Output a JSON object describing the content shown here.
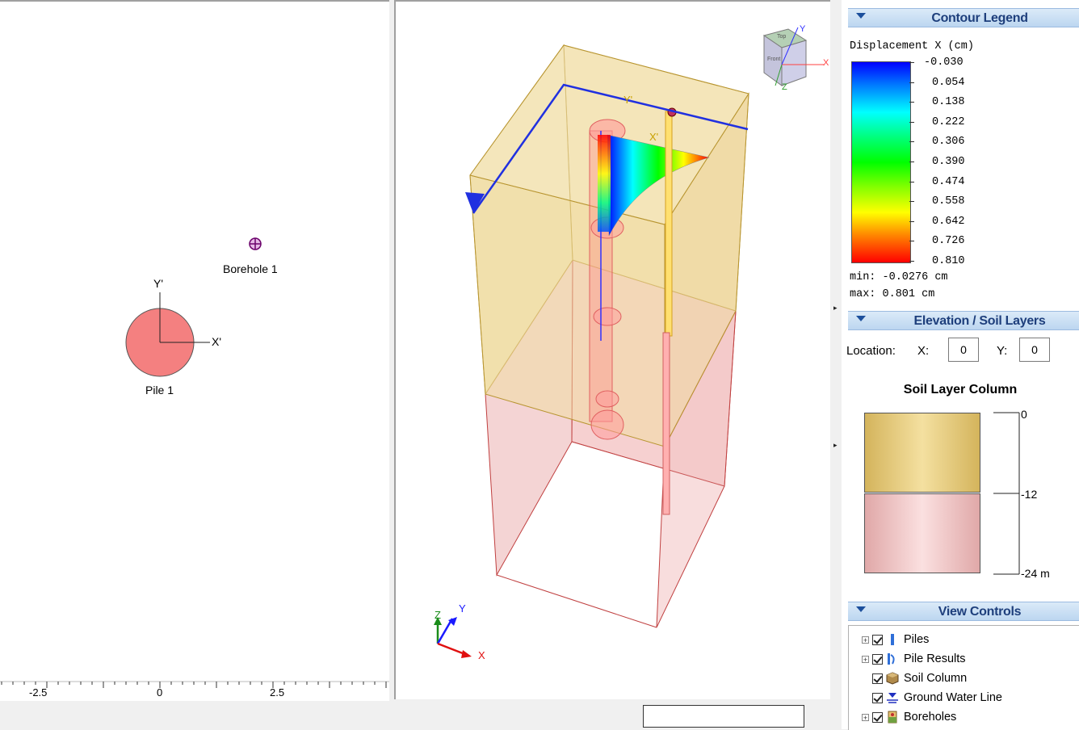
{
  "plan_view": {
    "borehole_label": "Borehole 1",
    "pile_label": "Pile 1",
    "axis_y_label": "Y'",
    "axis_x_label": "X'",
    "ruler_ticks": [
      "-2.5",
      "0",
      "2.5"
    ]
  },
  "view3d": {
    "pile_axis_y": "Y'",
    "pile_axis_x": "X'",
    "triad_z": "Z",
    "triad_y": "Y",
    "triad_x": "X",
    "cube_y": "Y",
    "cube_x": "X",
    "cube_z": "Z",
    "cube_face_top": "Top",
    "cube_face_front": "Front"
  },
  "contour_legend": {
    "title": "Contour Legend",
    "quantity": "Displacement X (cm)",
    "values": [
      "-0.030",
      "0.054",
      "0.138",
      "0.222",
      "0.306",
      "0.390",
      "0.474",
      "0.558",
      "0.642",
      "0.726",
      "0.810"
    ],
    "min_text": "min: -0.0276 cm",
    "max_text": "max: 0.801 cm",
    "colors": [
      "#0000ff",
      "#0080ff",
      "#00ffff",
      "#00ff80",
      "#00ff00",
      "#80ff00",
      "#ffff00",
      "#ff8000",
      "#ff0000"
    ]
  },
  "elevation": {
    "title": "Elevation / Soil Layers",
    "location_label": "Location:",
    "x_label": "X:",
    "x_value": "0",
    "y_label": "Y:",
    "y_value": "0",
    "column_title": "Soil Layer Column",
    "depths": [
      "0",
      "-12",
      "-24 m"
    ],
    "layer_colors": [
      "#e3cb79",
      "#f0c9c9"
    ]
  },
  "view_controls": {
    "title": "View Controls",
    "items": [
      "Piles",
      "Pile Results",
      "Soil Column",
      "Ground Water Line",
      "Boreholes"
    ]
  }
}
